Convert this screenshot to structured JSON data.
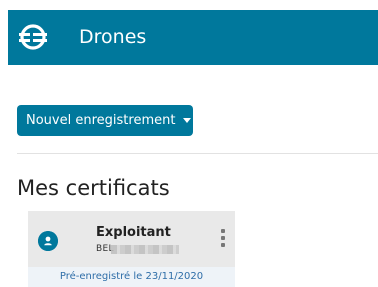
{
  "header": {
    "title": "Drones",
    "logo_icon": "drone-globe-logo-icon"
  },
  "toolbar": {
    "new_record_label": "Nouvel enregistrement",
    "new_record_icon": "caret-down-icon"
  },
  "section": {
    "heading": "Mes certificats"
  },
  "certificate_card": {
    "title": "Exploitant",
    "subtitle_prefix": "BEL",
    "avatar_icon": "user-icon",
    "menu_icon": "kebab-menu-icon",
    "footer": "Pré-enregistré le 23/11/2020"
  },
  "colors": {
    "brand": "#00789c",
    "link": "#2f6ea8",
    "card_bg": "#e9e9e9"
  }
}
